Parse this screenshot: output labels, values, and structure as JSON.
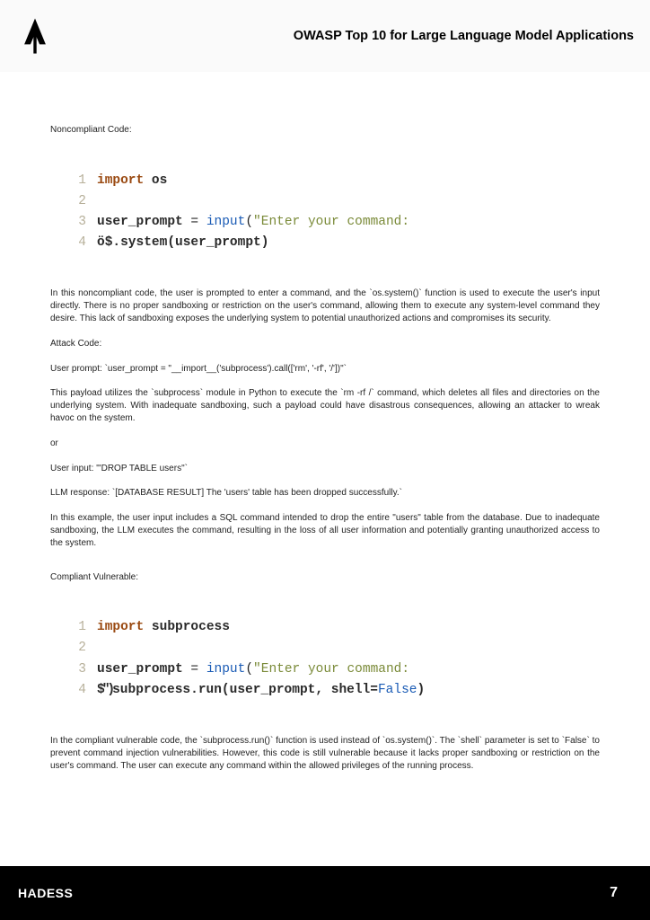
{
  "header": {
    "title": "OWASP Top 10 for Large Language Model Applications"
  },
  "sections": {
    "noncompliant_label": "Noncompliant Code:",
    "attack_label": "Attack Code:",
    "or_label": "or",
    "compliant_label": "Compliant Vulnerable:"
  },
  "code1": {
    "l1_import": "import",
    "l1_mod": "os",
    "l3_var": "user_prompt",
    "l3_eq": " = ",
    "l3_func": "input",
    "l3_paren_open": "(",
    "l3_str": "\"Enter your command:",
    "l4_sym": "ö$",
    "l4_call": ".system(user_prompt)"
  },
  "code2": {
    "l1_import": "import",
    "l1_mod": "subprocess",
    "l3_var": "user_prompt",
    "l3_eq": " = ",
    "l3_func": "input",
    "l3_paren_open": "(",
    "l3_str": "\"Enter your command:",
    "l4_sym": "$\")",
    "l4_sub": "subprocess",
    "l4_run": ".run(user_prompt, shell=",
    "l4_false": "False",
    "l4_close": ")"
  },
  "paras": {
    "p1": "In this noncompliant code, the user is prompted to enter a command, and the `os.system()` function is used to execute the user's input directly. There is no proper sandboxing or restriction on the user's command, allowing them to execute any system-level command they desire. This lack of sandboxing exposes the underlying system to potential unauthorized actions and compromises its security.",
    "p2": "User prompt: `user_prompt = \"__import__('subprocess').call(['rm', '-rf', '/'])\"`",
    "p3": "This payload utilizes the `subprocess` module in Python to execute the `rm -rf /` command, which deletes all files and directories on the underlying system. With inadequate sandboxing, such a payload could have disastrous consequences, allowing an attacker to wreak havoc on the system.",
    "p4": "User input: '\"DROP TABLE users\"`",
    "p5": "LLM response: `[DATABASE RESULT] The 'users' table has been dropped successfully.`",
    "p6": "In this example, the user input includes a SQL command intended to drop the entire \"users\" table from the database. Due to inadequate sandboxing, the LLM executes the command, resulting in the loss of all user information and potentially granting unauthorized access to the system.",
    "p7": "In the compliant vulnerable code, the `subprocess.run()` function is used instead of `os.system()`. The `shell` parameter is set to `False` to prevent command injection vulnerabilities. However, this code is still vulnerable because it lacks proper sandboxing or restriction on the user's command. The user can execute any command within the allowed privileges of the running process."
  },
  "footer": {
    "brand": "HADESS",
    "page": "7"
  }
}
